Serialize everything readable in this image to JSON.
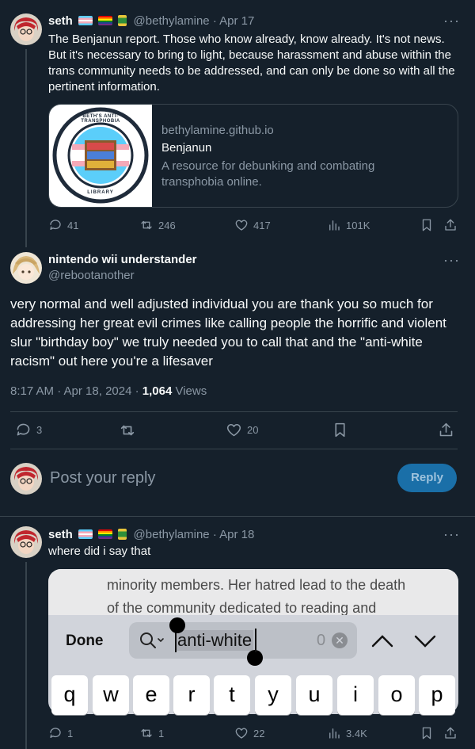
{
  "tweet1": {
    "name": "seth",
    "handle": "@bethylamine",
    "date": "Apr 17",
    "text": "The Benjanun report. Those who know already, know already. It's not news. But it's necessary to bring to light, because harassment and abuse within the trans community needs to be addressed, and can only be done so with all the pertinent information.",
    "card": {
      "domain": "bethylamine.github.io",
      "title": "Benjanun",
      "description": "A resource for debunking and combating transphobia online.",
      "logo_top": "BETH'S ANTI-TRANSPHOBIA",
      "logo_bottom": "LIBRARY"
    },
    "replies": "41",
    "retweets": "246",
    "likes": "417",
    "views": "101K"
  },
  "tweet2": {
    "name": "nintendo wii understander",
    "handle": "@rebootanother",
    "text": "very normal and well adjusted individual you are thank you so much for addressing her great evil crimes like calling people the horrific and violent slur \"birthday boy\" we truly needed you to call that and the \"anti-white racism\" out here you're a lifesaver",
    "timestamp": "8:17 AM · Apr 18, 2024 · ",
    "views_count": "1,064",
    "views_label": " Views",
    "replies": "3",
    "likes": "20"
  },
  "composer": {
    "placeholder": "Post your reply",
    "button": "Reply"
  },
  "tweet3": {
    "name": "seth",
    "handle": "@bethylamine",
    "date": "Apr 18",
    "text": "where did i say that",
    "screenshot": {
      "line1": "minority members. Her hatred lead to the death",
      "line2": "of the community dedicated to reading and",
      "done": "Done",
      "search_value": "anti-white",
      "match_count": "0",
      "keys": [
        "q",
        "w",
        "e",
        "r",
        "t",
        "y",
        "u",
        "i",
        "o",
        "p"
      ]
    },
    "replies": "1",
    "retweets": "1",
    "likes": "22",
    "views": "3.4K"
  },
  "colors": {
    "background": "#15202b",
    "accent": "#1d9bf0",
    "muted": "#8b98a5"
  }
}
